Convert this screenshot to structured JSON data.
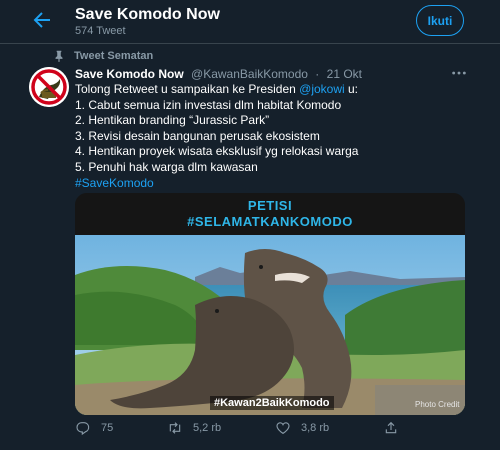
{
  "header": {
    "title": "Save Komodo Now",
    "tweet_count": "574 Tweet",
    "follow_label": "Ikuti"
  },
  "pinned_label": "Tweet Sematan",
  "tweet": {
    "author_name": "Save Komodo Now",
    "author_handle": "@KawanBaikKomodo",
    "separator": "·",
    "date": "21 Okt",
    "text_intro": "Tolong Retweet u sampaikan ke Presiden ",
    "mention": "@jokowi",
    "text_intro_end": " u:",
    "lines": [
      "1. Cabut semua izin investasi dlm habitat Komodo",
      "2. Hentikan branding “Jurassic Park”",
      "3. Revisi desain bangunan perusak ekosistem",
      "4. Hentikan proyek wisata eksklusif yg relokasi warga",
      "5. Penuhi hak warga dlm kawasan"
    ],
    "hashtag": "#SaveKomodo"
  },
  "media": {
    "banner_line1": "PETISI",
    "banner_line2": "#SELAMATKANKOMODO",
    "tag": "#Kawan2BaikKomodo",
    "credit": "Photo Credit"
  },
  "actions": {
    "replies": "75",
    "retweets": "5,2 rb",
    "likes": "3,8 rb"
  },
  "colors": {
    "background": "#15202b",
    "accent": "#1da1f2",
    "secondary_text": "#8899a6",
    "border": "#38444d"
  },
  "icons": [
    "back-arrow-icon",
    "pin-icon",
    "more-icon",
    "reply-icon",
    "retweet-icon",
    "like-icon",
    "share-icon"
  ]
}
